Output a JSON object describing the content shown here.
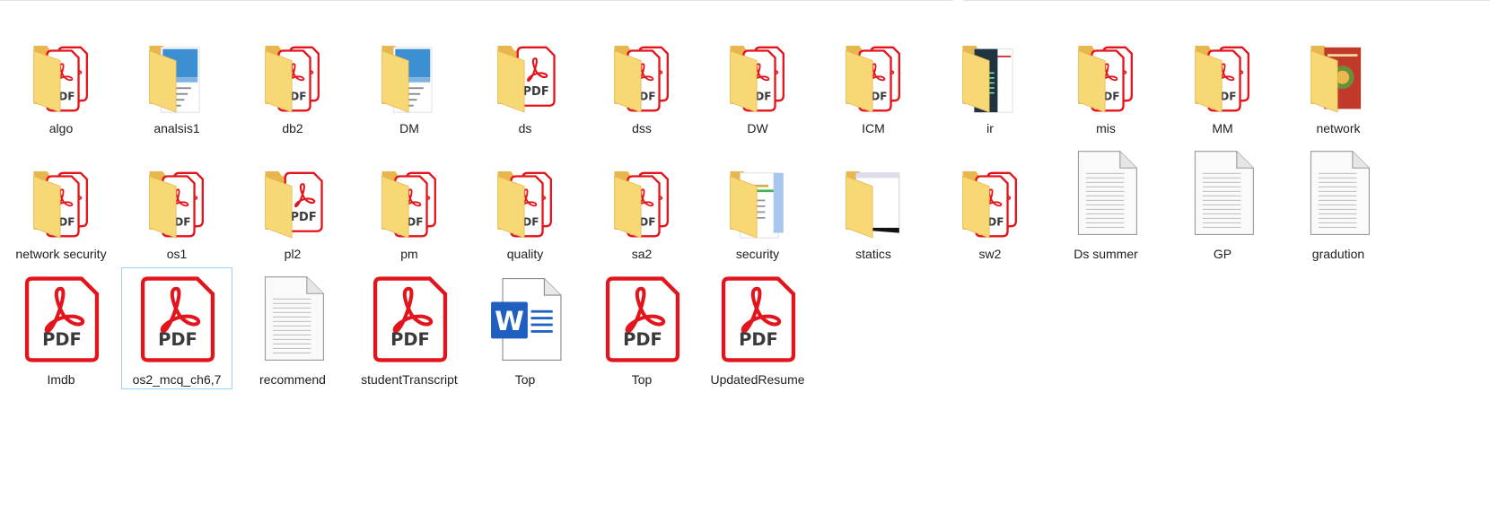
{
  "window": {
    "title": ""
  },
  "items": [
    {
      "name": "algo",
      "type": "folder",
      "preview": "pdf"
    },
    {
      "name": "analsis1",
      "type": "folder",
      "preview": "doc-blue"
    },
    {
      "name": "db2",
      "type": "folder",
      "preview": "pdf"
    },
    {
      "name": "DM",
      "type": "folder",
      "preview": "doc-blue"
    },
    {
      "name": "ds",
      "type": "folder",
      "preview": "pdf-big"
    },
    {
      "name": "dss",
      "type": "folder",
      "preview": "pdf"
    },
    {
      "name": "DW",
      "type": "folder",
      "preview": "pdf"
    },
    {
      "name": "ICM",
      "type": "folder",
      "preview": "pdf"
    },
    {
      "name": "ir",
      "type": "folder",
      "preview": "doc-dark"
    },
    {
      "name": "mis",
      "type": "folder",
      "preview": "pdf"
    },
    {
      "name": "MM",
      "type": "folder",
      "preview": "pdf"
    },
    {
      "name": "network",
      "type": "folder",
      "preview": "doc-red"
    },
    {
      "name": "network security",
      "type": "folder",
      "preview": "pdf"
    },
    {
      "name": "os1",
      "type": "folder",
      "preview": "pdf"
    },
    {
      "name": "pl2",
      "type": "folder",
      "preview": "pdf-big"
    },
    {
      "name": "pm",
      "type": "folder",
      "preview": "pdf"
    },
    {
      "name": "quality",
      "type": "folder",
      "preview": "pdf"
    },
    {
      "name": "sa2",
      "type": "folder",
      "preview": "pdf"
    },
    {
      "name": "security",
      "type": "folder",
      "preview": "doc-light"
    },
    {
      "name": "statics",
      "type": "folder",
      "preview": "doc-window"
    },
    {
      "name": "sw2",
      "type": "folder",
      "preview": "pdf"
    },
    {
      "name": "Ds summer",
      "type": "text"
    },
    {
      "name": "GP",
      "type": "text"
    },
    {
      "name": "gradution",
      "type": "text"
    },
    {
      "name": "Imdb",
      "type": "pdf"
    },
    {
      "name": "os2_mcq_ch6,7",
      "type": "pdf",
      "selected": true
    },
    {
      "name": "recommend",
      "type": "text"
    },
    {
      "name": "studentTranscript",
      "type": "pdf"
    },
    {
      "name": "Top",
      "type": "word"
    },
    {
      "name": "Top",
      "type": "pdf"
    },
    {
      "name": "UpdatedResume",
      "type": "pdf"
    }
  ],
  "icon_text": {
    "pdf": "PDF",
    "word": "W"
  },
  "colors": {
    "folder_back": "#e8b64c",
    "folder_front": "#f8d775",
    "pdf_red": "#e3141b",
    "word_blue": "#1f5fbf",
    "selection_border": "#99d1ff"
  }
}
